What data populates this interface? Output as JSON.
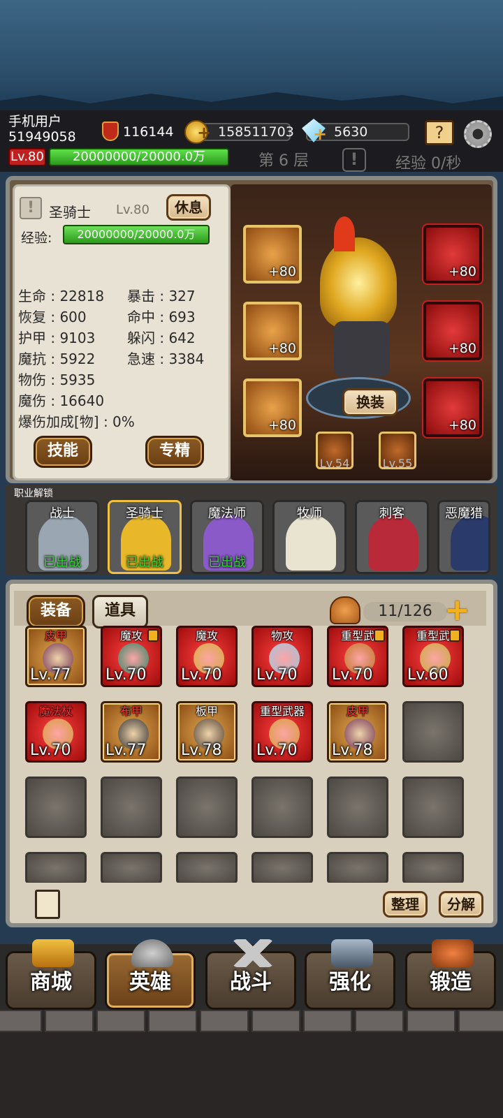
{
  "player": {
    "name": "手机用户",
    "id": "51949058",
    "level": "Lv.80",
    "exp_bar": "20000000/20000.0万",
    "power": "116144",
    "coins": "158511703",
    "gems": "5630",
    "floor": "第 6 层",
    "exp_rate": "经验 0/秒"
  },
  "hero": {
    "name": "圣骑士",
    "level": "Lv.80",
    "rest_button": "休息",
    "exp_label": "经验:",
    "exp_value": "20000000/20000.0万",
    "stats": [
      "生命 : 22818",
      "暴击 : 327",
      "恢复 : 600",
      "命中 : 693",
      "护甲 : 9103",
      "躲闪 : 642",
      "魔抗 : 5922",
      "急速 : 3384",
      "物伤 : 5935",
      "魔伤 : 16640",
      "爆伤加成[物] : 0%"
    ],
    "skill_button": "技能",
    "mastery_button": "专精",
    "change_button": "换装",
    "equip_left": [
      "+80",
      "+80",
      "+80"
    ],
    "equip_right": [
      "+80",
      "+80",
      "+80"
    ],
    "gems": [
      "Lv.54",
      "Lv.55"
    ]
  },
  "classes": {
    "title": "职业解锁",
    "list": [
      {
        "name": "战士",
        "status": "已出战",
        "color": "#9aa6b2"
      },
      {
        "name": "圣骑士",
        "status": "已出战",
        "color": "#e8b82a"
      },
      {
        "name": "魔法师",
        "status": "已出战",
        "color": "#8a5ac8"
      },
      {
        "name": "牧师",
        "status": "",
        "color": "#e8e4d0"
      },
      {
        "name": "刺客",
        "status": "",
        "color": "#b82a3a"
      },
      {
        "name": "恶魔猎",
        "status": "",
        "color": "#2a3a6a"
      }
    ]
  },
  "inventory": {
    "tab_equip": "装备",
    "tab_items": "道具",
    "count": "11/126",
    "sort_button": "整理",
    "decompose_button": "分解",
    "items": [
      {
        "name": "皮甲",
        "level": "Lv.77",
        "style": "gold",
        "name_red": true,
        "locked": false
      },
      {
        "name": "魔攻",
        "level": "Lv.70",
        "style": "red",
        "name_red": false,
        "locked": true
      },
      {
        "name": "魔攻",
        "level": "Lv.70",
        "style": "red",
        "name_red": false,
        "locked": false
      },
      {
        "name": "物攻",
        "level": "Lv.70",
        "style": "red",
        "name_red": false,
        "locked": false
      },
      {
        "name": "重型武",
        "level": "Lv.70",
        "style": "red",
        "name_red": false,
        "locked": true
      },
      {
        "name": "重型武",
        "level": "Lv.60",
        "style": "red",
        "name_red": false,
        "locked": true
      },
      {
        "name": "魔法杖",
        "level": "Lv.70",
        "style": "red",
        "name_red": true,
        "locked": false
      },
      {
        "name": "布甲",
        "level": "Lv.77",
        "style": "gold",
        "name_red": true,
        "locked": false
      },
      {
        "name": "板甲",
        "level": "Lv.78",
        "style": "gold",
        "name_red": false,
        "locked": false
      },
      {
        "name": "重型武器",
        "level": "Lv.70",
        "style": "red",
        "name_red": false,
        "locked": false
      },
      {
        "name": "皮甲",
        "level": "Lv.78",
        "style": "gold",
        "name_red": true,
        "locked": false
      }
    ]
  },
  "nav": [
    "商城",
    "英雄",
    "战斗",
    "强化",
    "锻造"
  ]
}
